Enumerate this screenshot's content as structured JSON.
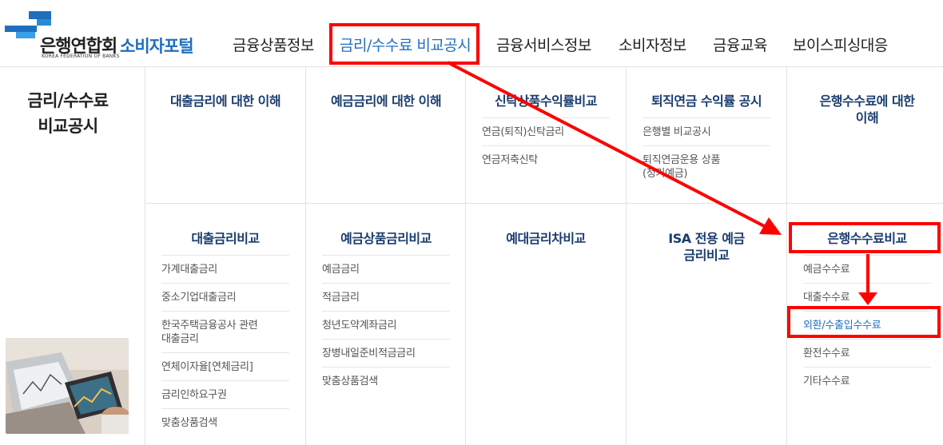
{
  "header": {
    "logo_text": "은행연합회",
    "logo_sub": "KOREA FEDERATION OF BANKS",
    "portal_title": "소비자포털",
    "nav": [
      {
        "label": "금융상품정보"
      },
      {
        "label": "금리/수수료 비교공시",
        "active": true
      },
      {
        "label": "금융서비스정보"
      },
      {
        "label": "소비자정보"
      },
      {
        "label": "금융교육"
      },
      {
        "label": "보이스피싱대응"
      }
    ]
  },
  "side": {
    "title_line1": "금리/수수료",
    "title_line2": "비교공시",
    "image_alt": "tablet-chart-photo"
  },
  "menu": {
    "row1": [
      {
        "title": "대출금리에 대한 이해",
        "items": []
      },
      {
        "title": "예금금리에 대한 이해",
        "items": []
      },
      {
        "title": "신탁상품수익률비교",
        "items": [
          "연금(퇴직)신탁금리",
          "연금저축신탁"
        ]
      },
      {
        "title": "퇴직연금 수익률 공시",
        "items": [
          "은행별 비교공시",
          "퇴직연금운용 상품\n(정기예금)"
        ]
      },
      {
        "title_line1": "은행수수료에 대한",
        "title_line2": "이해",
        "items": []
      }
    ],
    "row2": [
      {
        "title": "대출금리비교",
        "items": [
          "가계대출금리",
          "중소기업대출금리",
          "한국주택금융공사 관련\n대출금리",
          "연체이자율[연체금리]",
          "금리인하요구권",
          "맞춤상품검색"
        ]
      },
      {
        "title": "예금상품금리비교",
        "items": [
          "예금금리",
          "적금금리",
          "청년도약계좌금리",
          "장병내일준비적금금리",
          "맞춤상품검색"
        ]
      },
      {
        "title": "예대금리차비교",
        "items": []
      },
      {
        "title_line1": "ISA 전용 예금",
        "title_line2": "금리비교",
        "items": []
      },
      {
        "title": "은행수수료비교",
        "items": [
          "예금수수료",
          "대출수수료",
          "외환/수출입수수료",
          "환전수수료",
          "기타수수료"
        ]
      }
    ]
  },
  "colors": {
    "accent": "#1f6fbf",
    "title_navy": "#1a3d6e",
    "highlight_red": "#ff0000"
  }
}
